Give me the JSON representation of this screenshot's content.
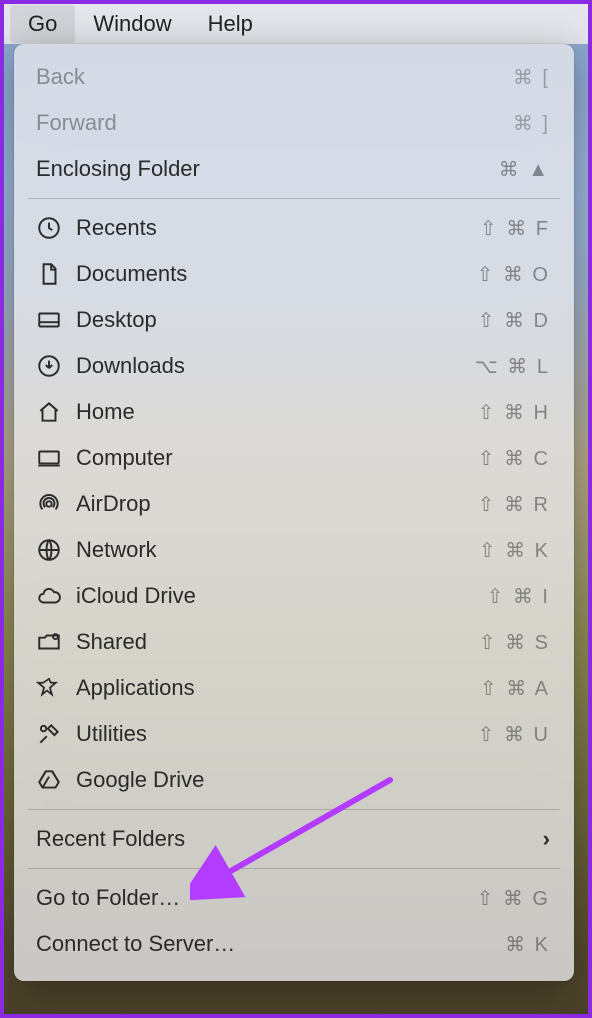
{
  "menubar": {
    "items": [
      {
        "label": "Go",
        "active": true
      },
      {
        "label": "Window",
        "active": false
      },
      {
        "label": "Help",
        "active": false
      }
    ]
  },
  "menu": {
    "nav": [
      {
        "label": "Back",
        "shortcut": "⌘ [",
        "disabled": true
      },
      {
        "label": "Forward",
        "shortcut": "⌘ ]",
        "disabled": true
      },
      {
        "label": "Enclosing Folder",
        "shortcut": "⌘ ▲",
        "disabled": false
      }
    ],
    "locations": [
      {
        "icon": "clock-icon",
        "label": "Recents",
        "shortcut": "⇧ ⌘ F"
      },
      {
        "icon": "document-icon",
        "label": "Documents",
        "shortcut": "⇧ ⌘ O"
      },
      {
        "icon": "desktop-icon",
        "label": "Desktop",
        "shortcut": "⇧ ⌘ D"
      },
      {
        "icon": "download-icon",
        "label": "Downloads",
        "shortcut": "⌥ ⌘ L"
      },
      {
        "icon": "home-icon",
        "label": "Home",
        "shortcut": "⇧ ⌘ H"
      },
      {
        "icon": "computer-icon",
        "label": "Computer",
        "shortcut": "⇧ ⌘ C"
      },
      {
        "icon": "airdrop-icon",
        "label": "AirDrop",
        "shortcut": "⇧ ⌘ R"
      },
      {
        "icon": "network-icon",
        "label": "Network",
        "shortcut": "⇧ ⌘ K"
      },
      {
        "icon": "cloud-icon",
        "label": "iCloud Drive",
        "shortcut": "⇧ ⌘ I"
      },
      {
        "icon": "shared-icon",
        "label": "Shared",
        "shortcut": "⇧ ⌘ S"
      },
      {
        "icon": "applications-icon",
        "label": "Applications",
        "shortcut": "⇧ ⌘ A"
      },
      {
        "icon": "utilities-icon",
        "label": "Utilities",
        "shortcut": "⇧ ⌘ U"
      },
      {
        "icon": "google-drive-icon",
        "label": "Google Drive",
        "shortcut": ""
      }
    ],
    "recent_folders": {
      "label": "Recent Folders",
      "has_submenu": true
    },
    "actions": [
      {
        "label": "Go to Folder…",
        "shortcut": "⇧ ⌘ G"
      },
      {
        "label": "Connect to Server…",
        "shortcut": "⌘ K"
      }
    ]
  },
  "annotation": {
    "color": "#b23cff",
    "target": "Go to Folder…"
  }
}
